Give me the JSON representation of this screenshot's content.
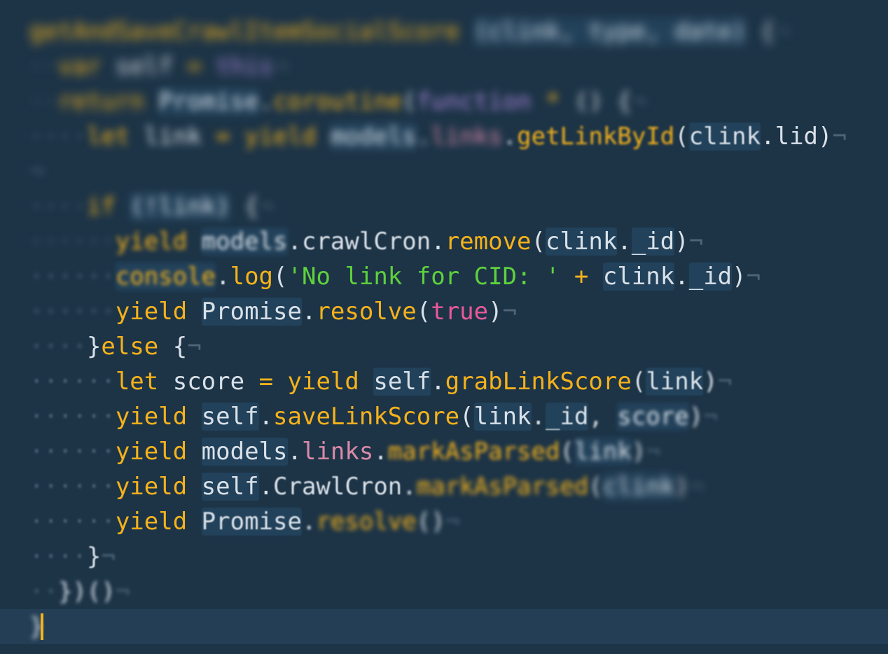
{
  "editor": {
    "theme_colors": {
      "background": "#1d3447",
      "keyword": "#f5b21b",
      "string": "#5ed13c",
      "boolean": "#e8599a",
      "identifier": "#d9e1e8",
      "invisibles": "#4f6577"
    },
    "lines": [
      {
        "tokens": [
          {
            "t": "getAndSaveCrawlItemSocialScore",
            "c": "fn",
            "b": "b8"
          },
          {
            "t": " ",
            "c": "pun"
          },
          {
            "t": "(clink, type, date)",
            "c": "id",
            "b": "b8",
            "h": true
          },
          {
            "t": " {",
            "c": "pun",
            "b": "b8"
          },
          {
            "t": "¬",
            "c": "inv",
            "b": "b8"
          }
        ]
      },
      {
        "tokens": [
          {
            "t": "··",
            "c": "inv",
            "b": "b8"
          },
          {
            "t": "var",
            "c": "kw",
            "b": "b8"
          },
          {
            "t": " ",
            "c": "pun"
          },
          {
            "t": "self",
            "c": "id",
            "b": "b8"
          },
          {
            "t": " = ",
            "c": "op",
            "b": "b8"
          },
          {
            "t": "this",
            "c": "mg",
            "b": "b8"
          },
          {
            "t": "¬",
            "c": "inv",
            "b": "b8"
          }
        ]
      },
      {
        "tokens": [
          {
            "t": "··",
            "c": "inv",
            "b": "b8"
          },
          {
            "t": "return",
            "c": "kw",
            "b": "b8"
          },
          {
            "t": " ",
            "c": "pun"
          },
          {
            "t": "Promise",
            "c": "id",
            "b": "b6",
            "h": true
          },
          {
            "t": ".",
            "c": "pun",
            "b": "b6"
          },
          {
            "t": "coroutine",
            "c": "fn",
            "b": "b6"
          },
          {
            "t": "(",
            "c": "pun",
            "b": "b6"
          },
          {
            "t": "function",
            "c": "mg",
            "b": "b6"
          },
          {
            "t": " * ",
            "c": "op",
            "b": "b6"
          },
          {
            "t": "() {",
            "c": "pun",
            "b": "b6"
          },
          {
            "t": "¬",
            "c": "inv",
            "b": "b6"
          }
        ]
      },
      {
        "tokens": [
          {
            "t": "····",
            "c": "inv",
            "b": "b6"
          },
          {
            "t": "let",
            "c": "kw",
            "b": "b6"
          },
          {
            "t": " ",
            "c": "pun"
          },
          {
            "t": "link",
            "c": "id",
            "b": "b6"
          },
          {
            "t": " = ",
            "c": "op",
            "b": "b6"
          },
          {
            "t": "yield",
            "c": "kw",
            "b": "b6"
          },
          {
            "t": " ",
            "c": "pun"
          },
          {
            "t": "models",
            "c": "id",
            "b": "b6",
            "h": true
          },
          {
            "t": ".",
            "c": "pun",
            "b": "b6"
          },
          {
            "t": "links",
            "c": "prop",
            "b": "b6"
          },
          {
            "t": ".",
            "c": "pun",
            "b": "b3"
          },
          {
            "t": "getLinkById",
            "c": "fn",
            "b": "b2"
          },
          {
            "t": "(",
            "c": "pun",
            "b": "b1"
          },
          {
            "t": "clink",
            "c": "id",
            "b": "b1",
            "h": true
          },
          {
            "t": ".",
            "c": "pun",
            "b": "b0"
          },
          {
            "t": "lid",
            "c": "id",
            "b": "b0"
          },
          {
            "t": ")",
            "c": "pun",
            "b": "b0"
          },
          {
            "t": "¬",
            "c": "inv",
            "b": "b0"
          }
        ]
      },
      {
        "tokens": [
          {
            "t": "¬",
            "c": "inv",
            "b": "b6"
          }
        ]
      },
      {
        "tokens": [
          {
            "t": "····",
            "c": "inv",
            "b": "b6"
          },
          {
            "t": "if",
            "c": "kw",
            "b": "b6"
          },
          {
            "t": " ",
            "c": "pun"
          },
          {
            "t": "(!link)",
            "c": "id",
            "b": "b6",
            "h": true
          },
          {
            "t": " {",
            "c": "pun",
            "b": "b6"
          },
          {
            "t": "¬",
            "c": "inv",
            "b": "b6"
          }
        ]
      },
      {
        "tokens": [
          {
            "t": "······",
            "c": "inv",
            "b": "b6"
          },
          {
            "t": "yield",
            "c": "kw",
            "b": "b4"
          },
          {
            "t": " ",
            "c": "pun"
          },
          {
            "t": "models",
            "c": "id",
            "b": "b3",
            "h": true
          },
          {
            "t": ".",
            "c": "pun",
            "b": "b1"
          },
          {
            "t": "crawlCron",
            "c": "id",
            "b": "b1"
          },
          {
            "t": ".",
            "c": "pun",
            "b": "b0"
          },
          {
            "t": "remove",
            "c": "fn",
            "b": "b0"
          },
          {
            "t": "(",
            "c": "pun",
            "b": "b0"
          },
          {
            "t": "clink",
            "c": "id",
            "b": "b0",
            "h": true
          },
          {
            "t": ".",
            "c": "pun",
            "b": "b0"
          },
          {
            "t": "_id",
            "c": "id",
            "b": "b0",
            "h": true
          },
          {
            "t": ")",
            "c": "pun",
            "b": "b0"
          },
          {
            "t": "¬",
            "c": "inv",
            "b": "b0"
          }
        ]
      },
      {
        "tokens": [
          {
            "t": "······",
            "c": "inv",
            "b": "b4"
          },
          {
            "t": "console",
            "c": "fn",
            "b": "b3",
            "h": true
          },
          {
            "t": ".",
            "c": "pun",
            "b": "b1"
          },
          {
            "t": "log",
            "c": "fn",
            "b": "b0"
          },
          {
            "t": "(",
            "c": "pun",
            "b": "b0"
          },
          {
            "t": "'No link for CID: '",
            "c": "str",
            "b": "b0"
          },
          {
            "t": " + ",
            "c": "op",
            "b": "b0"
          },
          {
            "t": "clink",
            "c": "id",
            "b": "b0",
            "h": true
          },
          {
            "t": ".",
            "c": "pun",
            "b": "b0"
          },
          {
            "t": "_id",
            "c": "id",
            "b": "b0",
            "h": true
          },
          {
            "t": ")",
            "c": "pun",
            "b": "b0"
          },
          {
            "t": "¬",
            "c": "inv",
            "b": "b0"
          }
        ]
      },
      {
        "tokens": [
          {
            "t": "······",
            "c": "inv",
            "b": "b4"
          },
          {
            "t": "yield",
            "c": "kw",
            "b": "b0"
          },
          {
            "t": " ",
            "c": "pun"
          },
          {
            "t": "Promise",
            "c": "id",
            "b": "b0",
            "h": true
          },
          {
            "t": ".",
            "c": "pun",
            "b": "b0"
          },
          {
            "t": "resolve",
            "c": "fn",
            "b": "b0"
          },
          {
            "t": "(",
            "c": "pun",
            "b": "b0"
          },
          {
            "t": "true",
            "c": "bool",
            "b": "b0"
          },
          {
            "t": ")",
            "c": "pun",
            "b": "b0"
          },
          {
            "t": "¬",
            "c": "inv",
            "b": "b0"
          }
        ]
      },
      {
        "tokens": [
          {
            "t": "····",
            "c": "inv",
            "b": "b3"
          },
          {
            "t": "}",
            "c": "pun",
            "b": "b0"
          },
          {
            "t": "else",
            "c": "kw",
            "b": "b0"
          },
          {
            "t": " {",
            "c": "pun",
            "b": "b0"
          },
          {
            "t": "¬",
            "c": "inv",
            "b": "b0"
          }
        ]
      },
      {
        "tokens": [
          {
            "t": "······",
            "c": "inv",
            "b": "b2"
          },
          {
            "t": "let",
            "c": "kw",
            "b": "b0"
          },
          {
            "t": " ",
            "c": "pun"
          },
          {
            "t": "score",
            "c": "id",
            "b": "b0"
          },
          {
            "t": " = ",
            "c": "op",
            "b": "b0"
          },
          {
            "t": "yield",
            "c": "kw",
            "b": "b0"
          },
          {
            "t": " ",
            "c": "pun"
          },
          {
            "t": "self",
            "c": "id",
            "b": "b0",
            "h": true
          },
          {
            "t": ".",
            "c": "pun",
            "b": "b0"
          },
          {
            "t": "grabLinkScore",
            "c": "fn",
            "b": "b0"
          },
          {
            "t": "(",
            "c": "pun",
            "b": "b1"
          },
          {
            "t": "link",
            "c": "id",
            "b": "b1",
            "h": true
          },
          {
            "t": ")",
            "c": "pun",
            "b": "b2"
          },
          {
            "t": "¬",
            "c": "inv",
            "b": "b2"
          }
        ]
      },
      {
        "tokens": [
          {
            "t": "······",
            "c": "inv",
            "b": "b2"
          },
          {
            "t": "yield",
            "c": "kw",
            "b": "b0"
          },
          {
            "t": " ",
            "c": "pun"
          },
          {
            "t": "self",
            "c": "id",
            "b": "b0",
            "h": true
          },
          {
            "t": ".",
            "c": "pun",
            "b": "b0"
          },
          {
            "t": "saveLinkScore",
            "c": "fn",
            "b": "b0"
          },
          {
            "t": "(",
            "c": "pun",
            "b": "b0"
          },
          {
            "t": "link",
            "c": "id",
            "b": "b0",
            "h": true
          },
          {
            "t": ".",
            "c": "pun",
            "b": "b1"
          },
          {
            "t": "_id",
            "c": "id",
            "b": "b1",
            "h": true
          },
          {
            "t": ", ",
            "c": "pun",
            "b": "b2"
          },
          {
            "t": "score",
            "c": "id",
            "b": "b3",
            "h": true
          },
          {
            "t": ")",
            "c": "pun",
            "b": "b3"
          },
          {
            "t": "¬",
            "c": "inv",
            "b": "b3"
          }
        ]
      },
      {
        "tokens": [
          {
            "t": "······",
            "c": "inv",
            "b": "b2"
          },
          {
            "t": "yield",
            "c": "kw",
            "b": "b0"
          },
          {
            "t": " ",
            "c": "pun"
          },
          {
            "t": "models",
            "c": "id",
            "b": "b0",
            "h": true
          },
          {
            "t": ".",
            "c": "pun",
            "b": "b0"
          },
          {
            "t": "links",
            "c": "prop",
            "b": "b0"
          },
          {
            "t": ".",
            "c": "pun",
            "b": "b1"
          },
          {
            "t": "markAsParsed",
            "c": "fn",
            "b": "b3"
          },
          {
            "t": "(",
            "c": "pun",
            "b": "b3"
          },
          {
            "t": "link",
            "c": "id",
            "b": "b4",
            "h": true
          },
          {
            "t": ")",
            "c": "pun",
            "b": "b4"
          },
          {
            "t": "¬",
            "c": "inv",
            "b": "b4"
          }
        ]
      },
      {
        "tokens": [
          {
            "t": "······",
            "c": "inv",
            "b": "b2"
          },
          {
            "t": "yield",
            "c": "kw",
            "b": "b0"
          },
          {
            "t": " ",
            "c": "pun"
          },
          {
            "t": "self",
            "c": "id",
            "b": "b0",
            "h": true
          },
          {
            "t": ".",
            "c": "pun",
            "b": "b0"
          },
          {
            "t": "CrawlCron",
            "c": "id",
            "b": "b1"
          },
          {
            "t": ".",
            "c": "pun",
            "b": "b2"
          },
          {
            "t": "markAsParsed",
            "c": "fn",
            "b": "b4"
          },
          {
            "t": "(",
            "c": "pun",
            "b": "b4"
          },
          {
            "t": "clink",
            "c": "id",
            "b": "b6",
            "h": true
          },
          {
            "t": ")",
            "c": "pun",
            "b": "b6"
          },
          {
            "t": "¬",
            "c": "inv",
            "b": "b6"
          }
        ]
      },
      {
        "tokens": [
          {
            "t": "······",
            "c": "inv",
            "b": "b2"
          },
          {
            "t": "yield",
            "c": "kw",
            "b": "b0"
          },
          {
            "t": " ",
            "c": "pun"
          },
          {
            "t": "Promise",
            "c": "id",
            "b": "b1",
            "h": true
          },
          {
            "t": ".",
            "c": "pun",
            "b": "b2"
          },
          {
            "t": "resolve",
            "c": "fn",
            "b": "b4"
          },
          {
            "t": "()",
            "c": "pun",
            "b": "b4"
          },
          {
            "t": "¬",
            "c": "inv",
            "b": "b4"
          }
        ]
      },
      {
        "tokens": [
          {
            "t": "····",
            "c": "inv",
            "b": "b2"
          },
          {
            "t": "}",
            "c": "pun",
            "b": "b1"
          },
          {
            "t": "¬",
            "c": "inv",
            "b": "b2"
          }
        ]
      },
      {
        "tokens": [
          {
            "t": "··",
            "c": "inv",
            "b": "b3"
          },
          {
            "t": "})()",
            "c": "pun",
            "b": "b3"
          },
          {
            "t": "¬",
            "c": "inv",
            "b": "b3"
          }
        ]
      },
      {
        "current": true,
        "tokens": [
          {
            "t": "}",
            "c": "pun",
            "b": "b4"
          }
        ]
      }
    ]
  }
}
